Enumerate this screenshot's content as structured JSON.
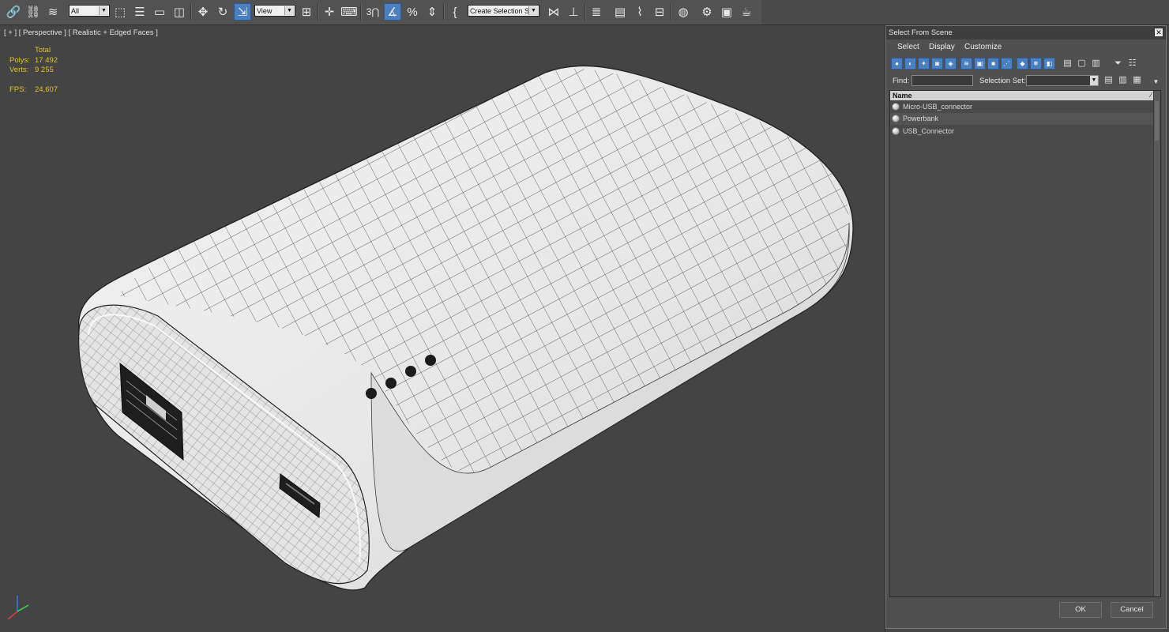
{
  "toolbar": {
    "selection_filter": "All",
    "coordinate_system": "View",
    "named_selection_placeholder": "Create Selection Se",
    "snap_angle_label": "3",
    "active_tool_color": "#4a7fc0",
    "icons": [
      "link-icon",
      "unlink-icon",
      "bind-space-warp-icon",
      "select-object-icon",
      "select-by-name-icon",
      "rect-region-icon",
      "window-crossing-icon",
      "move-icon",
      "rotate-icon",
      "scale-icon",
      "ref-coord-icon",
      "pivot-icon",
      "manipulate-icon",
      "keyboard-shortcut-icon",
      "snaps-toggle-icon",
      "angle-snap-icon",
      "percent-snap-icon",
      "spinner-snap-icon",
      "edit-named-sets-icon",
      "mirror-icon",
      "align-icon",
      "layer-manager-icon",
      "ribbon-icon",
      "curve-editor-icon",
      "schematic-view-icon",
      "material-editor-icon",
      "render-setup-icon",
      "rendered-frame-icon",
      "render-icon"
    ]
  },
  "viewport": {
    "label": "[ + ] [ Perspective ] [ Realistic + Edged Faces ]",
    "stats": {
      "header": "Total",
      "polys_label": "Polys:",
      "polys_value": "17 492",
      "verts_label": "Verts:",
      "verts_value": "9 255",
      "fps_label": "FPS:",
      "fps_value": "24,607"
    },
    "stat_color": "#e3c226",
    "model_name": "Powerbank"
  },
  "dialog": {
    "title": "Select From Scene",
    "close_icon": "✕",
    "menu": [
      "Select",
      "Display",
      "Customize"
    ],
    "find_label": "Find:",
    "find_value": "",
    "selection_set_label": "Selection Set:",
    "selection_set_value": "",
    "column_name": "Name",
    "objects": [
      "Micro-USB_connector",
      "Powerbank",
      "USB_Connector"
    ],
    "ok_label": "OK",
    "cancel_label": "Cancel"
  }
}
